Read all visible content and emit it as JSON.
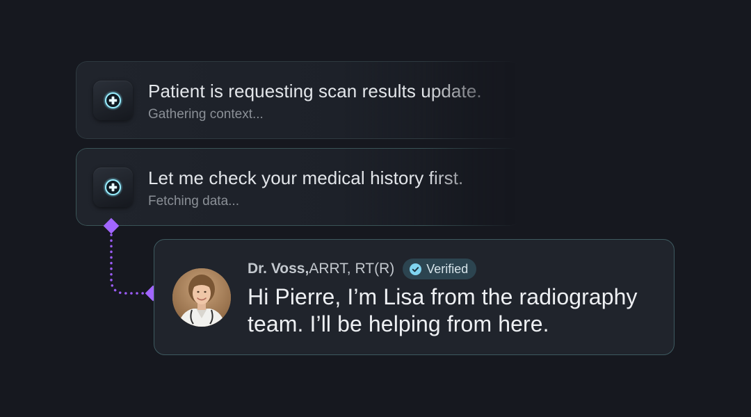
{
  "agent_updates": [
    {
      "title": "Patient is requesting scan results update.",
      "status": "Gathering context...",
      "icon": "medical-cross-icon"
    },
    {
      "title": "Let me check your medical history first.",
      "status": "Fetching data...",
      "icon": "medical-cross-icon"
    }
  ],
  "reply": {
    "name": "Dr. Voss,",
    "credentials": " ARRT, RT(R)",
    "badge": "Verified",
    "message": "Hi Pierre, I’m Lisa from the radiography team. I’ll be helping from here.",
    "avatar": "doctor-avatar"
  },
  "colors": {
    "background": "#16181f",
    "card": "#20242c",
    "accent_cyan": "#5fd3ee",
    "connector_purple": "#9b5cf6",
    "badge_bg": "#2c4450"
  }
}
